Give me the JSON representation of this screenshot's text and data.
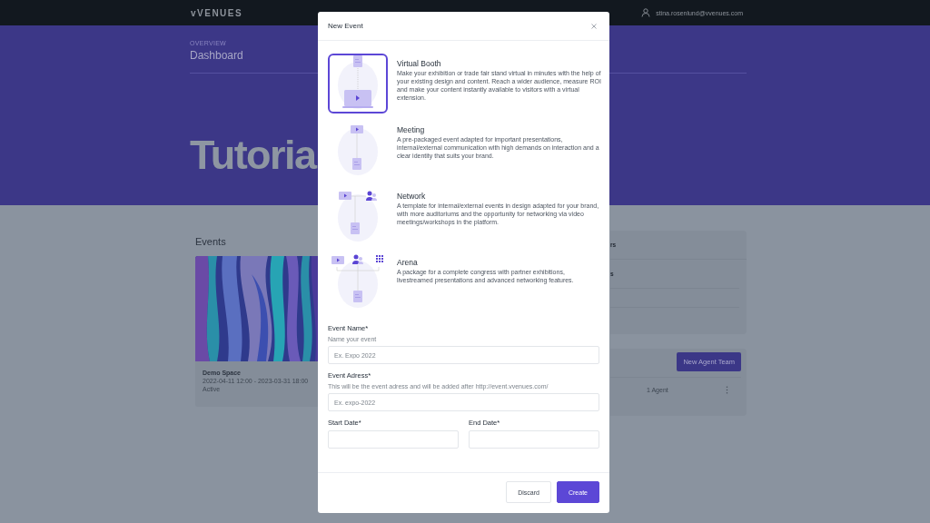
{
  "nav": {
    "logo": "vVENUES",
    "email": "stina.rosenlund@vvenues.com"
  },
  "hero": {
    "eyebrow": "OVERVIEW",
    "title": "Dashboard",
    "big_text": "Tutoria"
  },
  "events": {
    "heading": "Events",
    "card": {
      "kind": "picture",
      "title": "Demo Space",
      "dates": "2022-04-11 12:00 - 2023-03-31 18:00",
      "status": "Active"
    }
  },
  "side_panel": {
    "fragments": [
      "rs",
      "s"
    ]
  },
  "agent_teams": {
    "button": "New Agent Team",
    "row": {
      "count": "1 Agent"
    }
  },
  "modal": {
    "title": "New Event",
    "templates": [
      {
        "kind": "booth",
        "name": "Virtual Booth",
        "description": "Make your exhibition or trade fair stand virtual in minutes with the help of your existing design and content. Reach a wider audience, measure ROI and make your content instantly available to visitors with a virtual extension.",
        "selected": true
      },
      {
        "kind": "meeting",
        "name": "Meeting",
        "description": "A pre-packaged event adapted for important presentations, internal/external communication with high demands on interaction and a clear identity that suits your brand.",
        "selected": false
      },
      {
        "kind": "network",
        "name": "Network",
        "description": "A template for internal/external events in design adapted for your brand, with more auditoriums and the opportunity for networking via video meetings/workshops in the platform.",
        "selected": false
      },
      {
        "kind": "arena",
        "name": "Arena",
        "description": "A package for a complete congress with partner exhibitions, livestreamed presentations and advanced networking features.",
        "selected": false
      }
    ],
    "fields": [
      {
        "label": "Event Name*",
        "hint": "Name your event",
        "placeholder": "Ex. Expo 2022"
      },
      {
        "label": "Event Adress*",
        "hint": "This will be the event adress and will be added after http://event.vvenues.com/",
        "placeholder": "Ex. expo-2022"
      }
    ],
    "date_fields": [
      {
        "label": "Start Date*"
      },
      {
        "label": "End Date*"
      }
    ],
    "buttons": {
      "discard": "Discard",
      "create": "Create"
    }
  }
}
